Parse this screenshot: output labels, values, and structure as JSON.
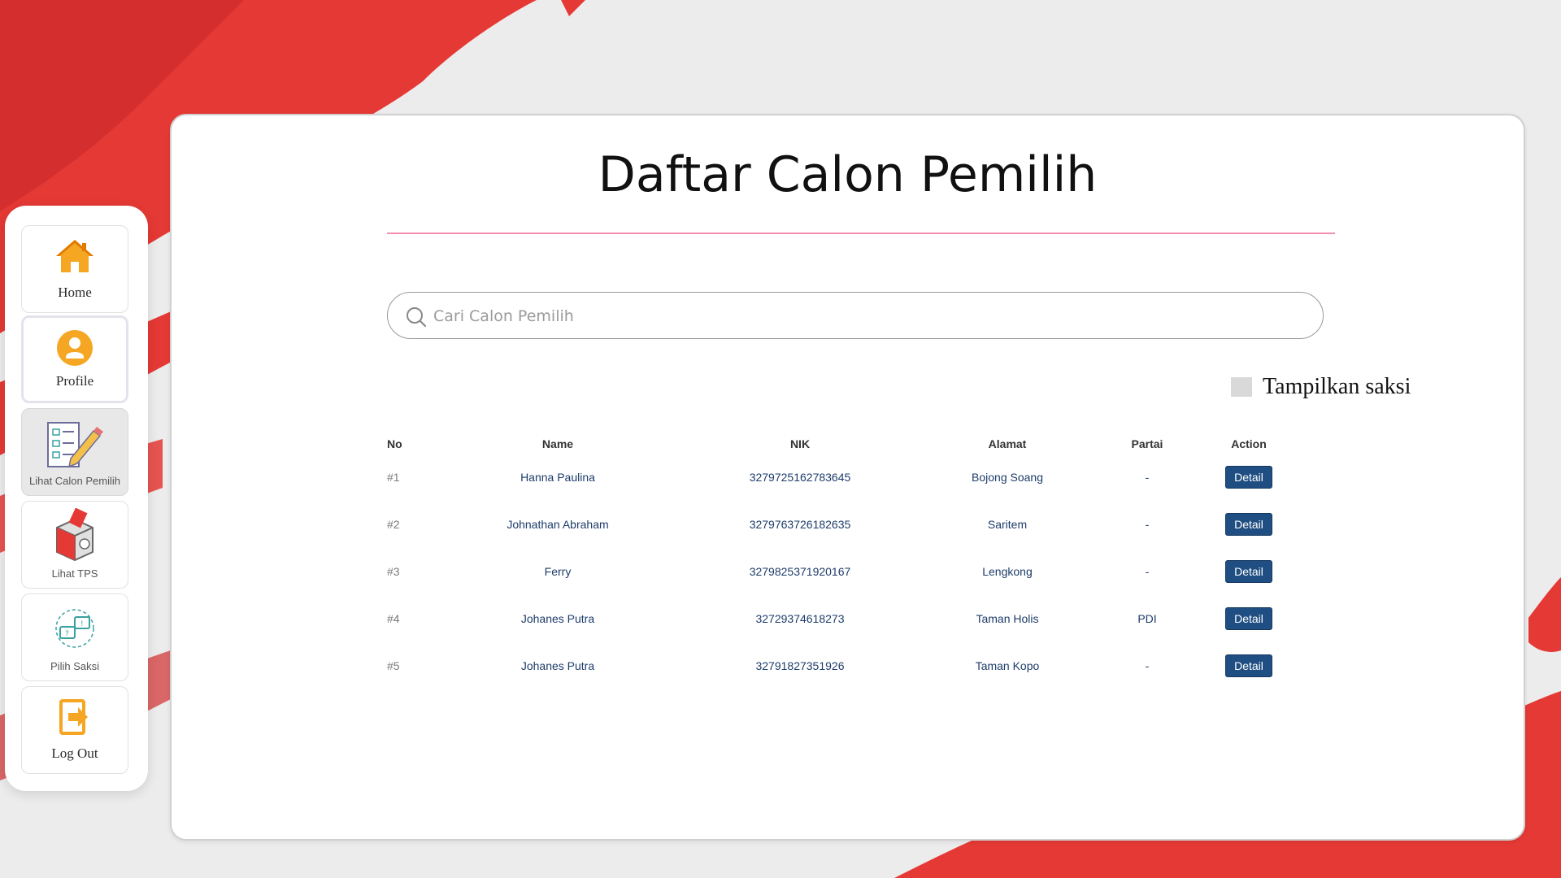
{
  "sidebar": {
    "items": [
      {
        "label": "Home",
        "icon": "home-icon"
      },
      {
        "label": "Profile",
        "icon": "user-icon"
      },
      {
        "label": "Lihat Calon Pemilih",
        "icon": "checklist-icon",
        "active": true
      },
      {
        "label": "Lihat TPS",
        "icon": "ballot-box-icon"
      },
      {
        "label": "Pilih Saksi",
        "icon": "exchange-icon"
      },
      {
        "label": "Log Out",
        "icon": "logout-icon"
      }
    ]
  },
  "main": {
    "title": "Daftar Calon Pemilih",
    "search": {
      "placeholder": "Cari Calon Pemilih",
      "value": ""
    },
    "toggle": {
      "label": "Tampilkan saksi",
      "checked": false
    },
    "table": {
      "headers": [
        "No",
        "Name",
        "NIK",
        "Alamat",
        "Partai",
        "Action"
      ],
      "rows": [
        {
          "no": "#1",
          "name": "Hanna Paulina",
          "nik": "3279725162783645",
          "alamat": "Bojong Soang",
          "partai": "-",
          "action": "Detail"
        },
        {
          "no": "#2",
          "name": "Johnathan Abraham",
          "nik": "3279763726182635",
          "alamat": "Saritem",
          "partai": "-",
          "action": "Detail"
        },
        {
          "no": "#3",
          "name": "Ferry",
          "nik": "3279825371920167",
          "alamat": "Lengkong",
          "partai": "-",
          "action": "Detail"
        },
        {
          "no": "#4",
          "name": "Johanes Putra",
          "nik": "32729374618273",
          "alamat": "Taman Holis",
          "partai": "PDI",
          "action": "Detail"
        },
        {
          "no": "#5",
          "name": "Johanes Putra",
          "nik": "32791827351926",
          "alamat": "Taman Kopo",
          "partai": "-",
          "action": "Detail"
        }
      ]
    }
  },
  "colors": {
    "accent_red": "#e53935",
    "button_blue": "#1f4e82",
    "rule_pink": "#f48fb1",
    "icon_orange": "#f5a623"
  }
}
